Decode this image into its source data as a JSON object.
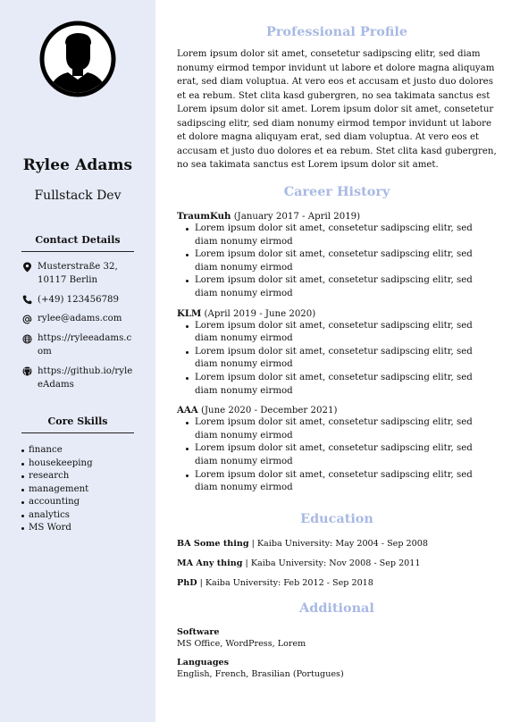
{
  "sidebar": {
    "name": "Rylee Adams",
    "role": "Fullstack Dev",
    "avatar_icon": "user-silhouette-icon",
    "contact_title": "Contact Details",
    "contact": [
      {
        "icon": "location-pin-icon",
        "text": "Musterstraße 32, 10117 Berlin"
      },
      {
        "icon": "phone-icon",
        "text": "(+49) 123456789"
      },
      {
        "icon": "at-sign-icon",
        "text": "rylee@adams.com"
      },
      {
        "icon": "globe-icon",
        "text": "https://ryleeadams.com"
      },
      {
        "icon": "github-icon",
        "text": "https://github.io/ryleeAdams"
      }
    ],
    "skills_title": "Core Skills",
    "skills": [
      "finance",
      "housekeeping",
      "research",
      "management",
      "accounting",
      "analytics",
      "MS Word"
    ]
  },
  "main": {
    "profile_heading": "Professional Profile",
    "profile_text": "Lorem ipsum dolor sit amet, consetetur sadipscing elitr, sed diam nonumy eirmod tempor invidunt ut labore et dolore magna aliquyam erat, sed diam voluptua. At vero eos et accusam et justo duo dolores et ea rebum. Stet clita kasd gubergren, no sea takimata sanctus est Lorem ipsum dolor sit amet. Lorem ipsum dolor sit amet, consetetur sadipscing elitr, sed diam nonumy eirmod tempor invidunt ut labore et dolore magna aliquyam erat, sed diam voluptua. At vero eos et accusam et justo duo dolores et ea rebum. Stet clita kasd gubergren, no sea takimata sanctus est Lorem ipsum dolor sit amet.",
    "career_heading": "Career History",
    "jobs": [
      {
        "company": "TraumKuh",
        "period": "(January 2017 - April 2019)",
        "bullets": [
          "Lorem ipsum dolor sit amet, consetetur sadipscing elitr, sed diam nonumy eirmod",
          "Lorem ipsum dolor sit amet, consetetur sadipscing elitr, sed diam nonumy eirmod",
          "Lorem ipsum dolor sit amet, consetetur sadipscing elitr, sed diam nonumy eirmod"
        ]
      },
      {
        "company": "KLM",
        "period": "(April 2019 - June 2020)",
        "bullets": [
          "Lorem ipsum dolor sit amet, consetetur sadipscing elitr, sed diam nonumy eirmod",
          "Lorem ipsum dolor sit amet, consetetur sadipscing elitr, sed diam nonumy eirmod",
          "Lorem ipsum dolor sit amet, consetetur sadipscing elitr, sed diam nonumy eirmod"
        ]
      },
      {
        "company": "AAA",
        "period": "(June 2020 - December 2021)",
        "bullets": [
          "Lorem ipsum dolor sit amet, consetetur sadipscing elitr, sed diam nonumy eirmod",
          "Lorem ipsum dolor sit amet, consetetur sadipscing elitr, sed diam nonumy eirmod",
          "Lorem ipsum dolor sit amet, consetetur sadipscing elitr, sed diam nonumy eirmod"
        ]
      }
    ],
    "education_heading": "Education",
    "education": [
      {
        "degree": "BA Some thing",
        "detail": " | Kaiba University: May 2004 - Sep 2008"
      },
      {
        "degree": "MA Any thing",
        "detail": " | Kaiba University: Nov 2008 - Sep 2011"
      },
      {
        "degree": "PhD",
        "detail": " | Kaiba University: Feb 2012 - Sep 2018"
      }
    ],
    "additional_heading": "Additional",
    "additional": [
      {
        "label": "Software",
        "value": "MS Office, WordPress, Lorem"
      },
      {
        "label": "Languages",
        "value": "English, French, Brasilian (Portugues)"
      }
    ]
  },
  "colors": {
    "sidebar_bg": "#e7ebf7",
    "heading_accent": "#a8b9e3",
    "text": "#111111"
  }
}
